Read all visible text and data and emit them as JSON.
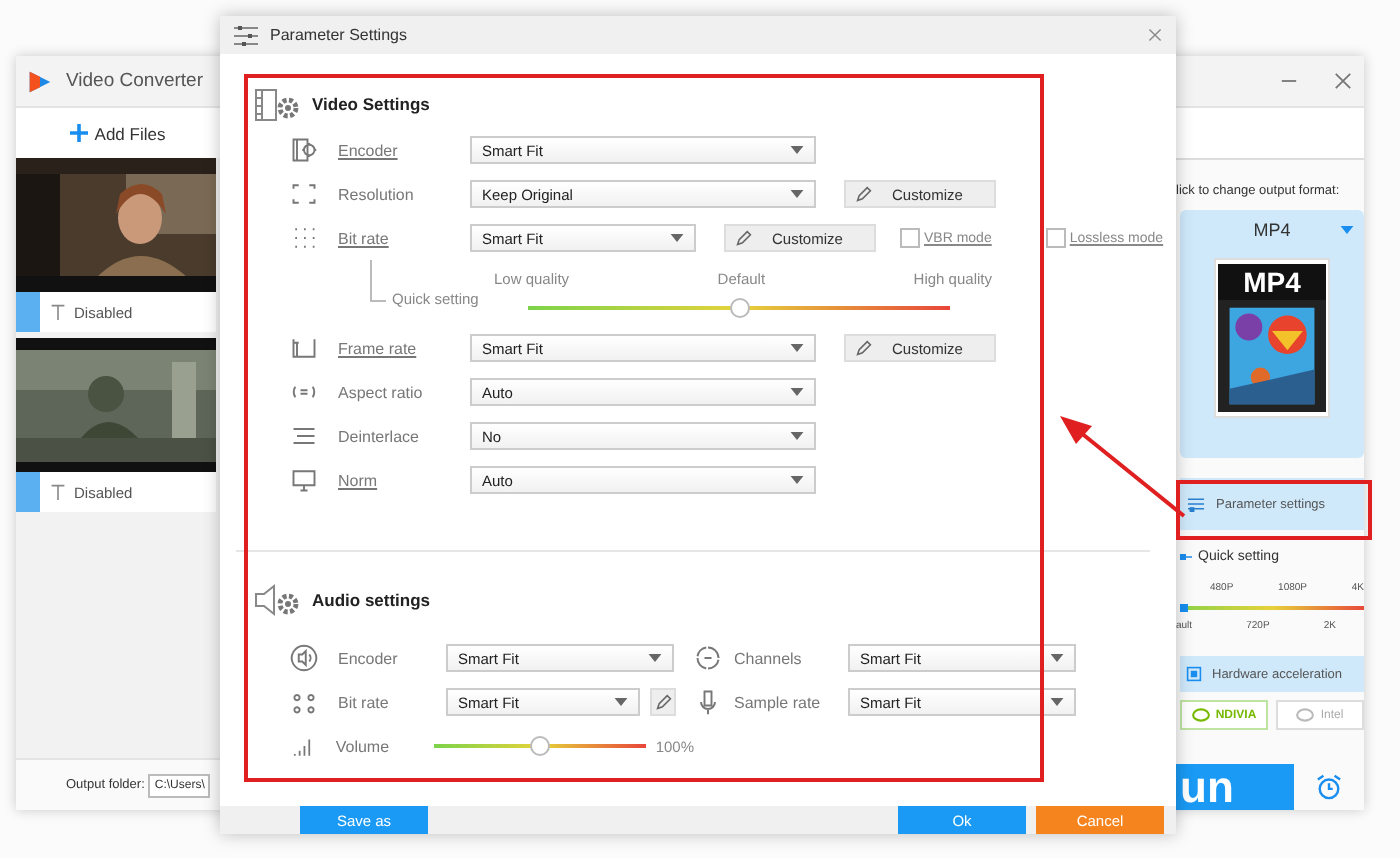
{
  "app_window": {
    "title": "Video Converter",
    "add_files": "Add Files",
    "files": [
      {
        "subtitle": "Disabled"
      },
      {
        "subtitle": "Disabled"
      }
    ],
    "output_folder": {
      "label": "Output folder:",
      "value": "C:\\Users\\"
    },
    "format_hint": "lick to change output format:",
    "format": {
      "name": "MP4",
      "badge": "MP4"
    },
    "parameter_settings": "Parameter settings",
    "quick_setting": {
      "label": "Quick setting",
      "level": 0,
      "top_labels": [
        "480P",
        "1080P",
        "4K"
      ],
      "bottom_labels": [
        "ault",
        "720P",
        "2K"
      ]
    },
    "hardware_acceleration": "Hardware acceleration",
    "gpu_buttons": [
      {
        "label": "NDIVIA",
        "selected": true
      },
      {
        "label": "Intel",
        "selected": false
      }
    ],
    "run_button": "un"
  },
  "dialog": {
    "title": "Parameter Settings",
    "video": {
      "heading": "Video Settings",
      "rows": [
        {
          "kind": "select",
          "label": "Encoder",
          "link": true,
          "value": "Smart Fit"
        },
        {
          "kind": "select",
          "label": "Resolution",
          "link": false,
          "value": "Keep Original",
          "button": "Customize"
        },
        {
          "kind": "bitrate",
          "label": "Bit rate",
          "link": true,
          "value": "Smart Fit",
          "button": "Customize",
          "checks": [
            {
              "label": "VBR mode",
              "checked": false
            },
            {
              "label": "Lossless mode",
              "checked": false
            }
          ]
        },
        {
          "kind": "quality",
          "label": "Quick setting",
          "scale": [
            "Low quality",
            "Default",
            "High quality"
          ],
          "level": 0.5
        },
        {
          "kind": "select",
          "label": "Frame rate",
          "link": true,
          "value": "Smart Fit",
          "button": "Customize"
        },
        {
          "kind": "select",
          "label": "Aspect ratio",
          "link": false,
          "value": "Auto"
        },
        {
          "kind": "select",
          "label": "Deinterlace",
          "link": false,
          "value": "No"
        },
        {
          "kind": "select",
          "label": "Norm",
          "link": true,
          "value": "Auto"
        }
      ]
    },
    "audio": {
      "heading": "Audio settings",
      "left": [
        {
          "kind": "select",
          "label": "Encoder",
          "value": "Smart Fit"
        },
        {
          "kind": "select",
          "label": "Bit rate",
          "value": "Smart Fit",
          "edit": true
        },
        {
          "kind": "slider",
          "label": "Volume",
          "level": 0.5,
          "reading": "100%"
        }
      ],
      "right": [
        {
          "kind": "select",
          "label": "Channels",
          "value": "Smart Fit"
        },
        {
          "kind": "select",
          "label": "Sample rate",
          "value": "Smart Fit"
        }
      ]
    },
    "save_button": "Save as",
    "buttons": [
      {
        "label": "Ok",
        "kind": "confirm"
      },
      {
        "label": "Cancel",
        "kind": "cancel"
      }
    ]
  }
}
